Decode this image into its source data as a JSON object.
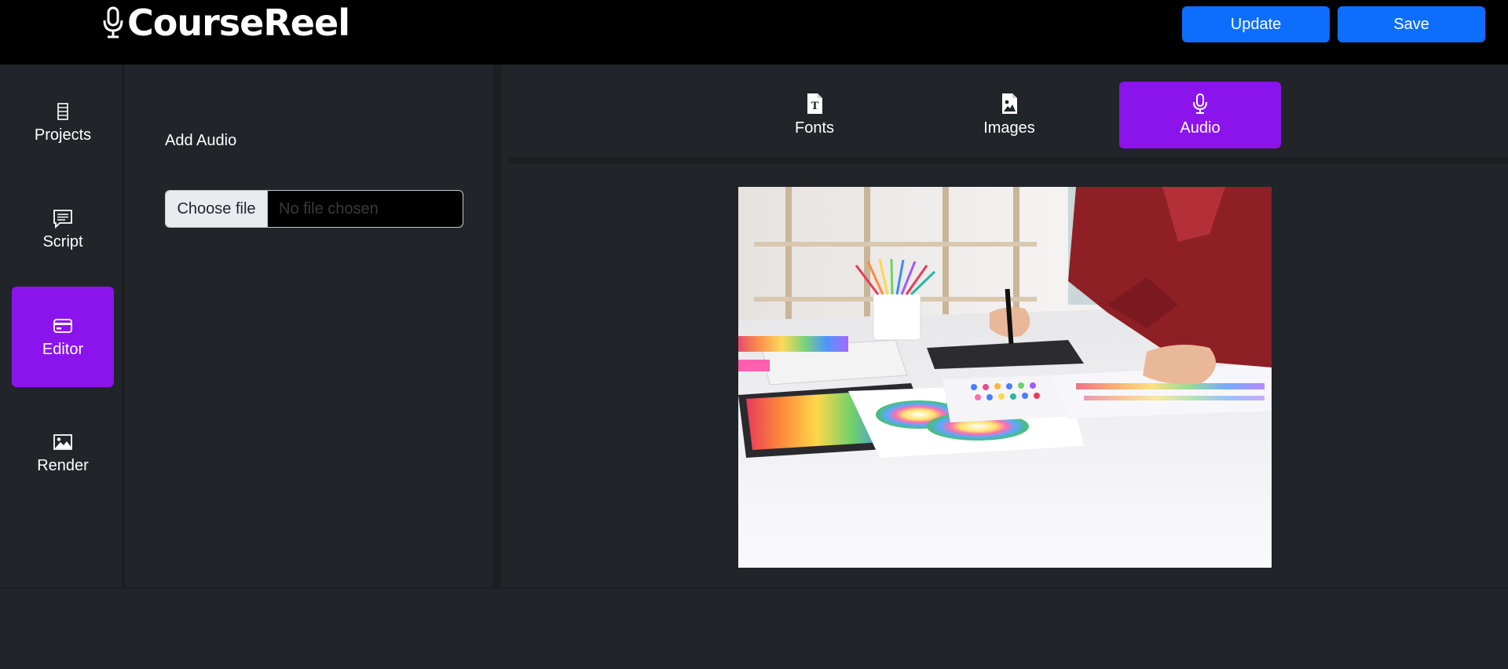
{
  "app": {
    "brand": "CourseReel"
  },
  "header": {
    "update_label": "Update",
    "save_label": "Save"
  },
  "sidebar": {
    "items": [
      {
        "label": "Projects",
        "icon": "list-icon",
        "active": false
      },
      {
        "label": "Script",
        "icon": "script-icon",
        "active": false
      },
      {
        "label": "Editor",
        "icon": "card-icon",
        "active": true
      },
      {
        "label": "Render",
        "icon": "image-icon",
        "active": false
      }
    ]
  },
  "panel": {
    "title": "Add Audio",
    "file_button": "Choose file",
    "file_status": "No file chosen"
  },
  "tabs": [
    {
      "label": "Fonts",
      "icon": "font-file-icon",
      "active": false
    },
    {
      "label": "Images",
      "icon": "image-file-icon",
      "active": false
    },
    {
      "label": "Audio",
      "icon": "microphone-icon",
      "active": true
    }
  ],
  "preview": {
    "subject": "designer-desk-photo"
  },
  "colors": {
    "header_bg": "#000000",
    "body_bg": "#212429",
    "accent_purple": "#8b14ed",
    "primary_blue": "#0d6efd"
  }
}
